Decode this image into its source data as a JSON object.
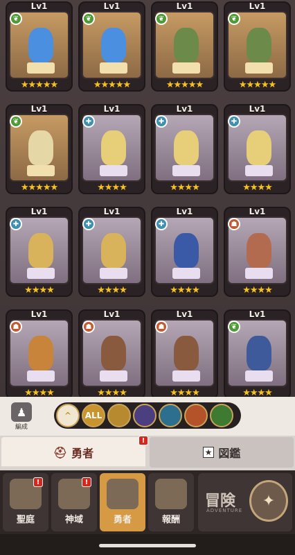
{
  "cards": [
    {
      "level": "Lv1",
      "element": "nature",
      "frame": "gold",
      "stars": "★★★★★",
      "hero_color": "#4b8fe0"
    },
    {
      "level": "Lv1",
      "element": "nature",
      "frame": "gold",
      "stars": "★★★★★",
      "hero_color": "#4b8fe0"
    },
    {
      "level": "Lv1",
      "element": "nature",
      "frame": "gold",
      "stars": "★★★★★",
      "hero_color": "#6c8a4a"
    },
    {
      "level": "Lv1",
      "element": "nature",
      "frame": "gold",
      "stars": "★★★★★",
      "hero_color": "#6c8a4a"
    },
    {
      "level": "Lv1",
      "element": "nature",
      "frame": "gold",
      "stars": "★★★★★",
      "hero_color": "#e6d7a6"
    },
    {
      "level": "Lv1",
      "element": "ice",
      "frame": "purple",
      "stars": "★★★★",
      "hero_color": "#e7cf7a"
    },
    {
      "level": "Lv1",
      "element": "ice",
      "frame": "purple",
      "stars": "★★★★",
      "hero_color": "#e7cf7a"
    },
    {
      "level": "Lv1",
      "element": "ice",
      "frame": "purple",
      "stars": "★★★★",
      "hero_color": "#e7cf7a"
    },
    {
      "level": "Lv1",
      "element": "ice",
      "frame": "purple",
      "stars": "★★★★",
      "hero_color": "#d9b35b"
    },
    {
      "level": "Lv1",
      "element": "ice",
      "frame": "purple",
      "stars": "★★★★",
      "hero_color": "#d9b35b"
    },
    {
      "level": "Lv1",
      "element": "ice",
      "frame": "purple",
      "stars": "★★★★",
      "hero_color": "#3a5aa8"
    },
    {
      "level": "Lv1",
      "element": "fire",
      "frame": "purple",
      "stars": "★★★★",
      "hero_color": "#b26b4f"
    },
    {
      "level": "Lv1",
      "element": "fire",
      "frame": "purple",
      "stars": "★★★★",
      "hero_color": "#c7843a"
    },
    {
      "level": "Lv1",
      "element": "fire",
      "frame": "purple",
      "stars": "★★★★",
      "hero_color": "#8a5a3e"
    },
    {
      "level": "Lv1",
      "element": "fire",
      "frame": "purple",
      "stars": "★★★★",
      "hero_color": "#8a5a3e"
    },
    {
      "level": "Lv1",
      "element": "nature",
      "frame": "purple",
      "stars": "★★★★",
      "hero_color": "#3f5a9a"
    }
  ],
  "formation_label": "編成",
  "filters": [
    {
      "icon": "chevron-up-icon",
      "label": "^"
    },
    {
      "icon": "all-icon",
      "label": "ALL"
    },
    {
      "icon": "light-element-icon",
      "label": ""
    },
    {
      "icon": "dark-element-icon",
      "label": ""
    },
    {
      "icon": "ice-element-icon",
      "label": ""
    },
    {
      "icon": "fire-element-icon",
      "label": ""
    },
    {
      "icon": "nature-element-icon",
      "label": ""
    }
  ],
  "tabs": {
    "heroes": "勇者",
    "encyclopedia": "図鑑",
    "alert_mark": "!"
  },
  "nav": [
    {
      "label": "聖庭",
      "alert": "!"
    },
    {
      "label": "神域",
      "alert": "!"
    },
    {
      "label": "勇者",
      "alert": ""
    },
    {
      "label": "報酬",
      "alert": ""
    }
  ],
  "adventure": {
    "title": "冒険",
    "subtitle": "ADVENTURE"
  },
  "colors": {
    "accent": "#d69a45",
    "alert": "#d8261d",
    "star": "#f4c225"
  }
}
